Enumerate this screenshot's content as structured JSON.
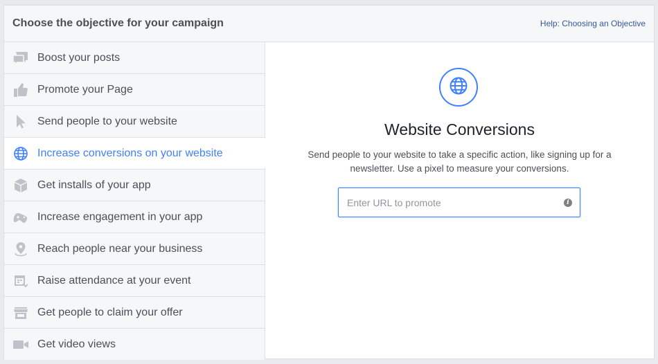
{
  "header": {
    "title": "Choose the objective for your campaign",
    "help_link": "Help: Choosing an Objective"
  },
  "sidebar": {
    "items": [
      {
        "label": "Boost your posts",
        "icon": "speech-bubbles-icon",
        "active": false
      },
      {
        "label": "Promote your Page",
        "icon": "thumbs-up-icon",
        "active": false
      },
      {
        "label": "Send people to your website",
        "icon": "cursor-icon",
        "active": false
      },
      {
        "label": "Increase conversions on your website",
        "icon": "globe-icon",
        "active": true
      },
      {
        "label": "Get installs of your app",
        "icon": "box-icon",
        "active": false
      },
      {
        "label": "Increase engagement in your app",
        "icon": "gamepad-icon",
        "active": false
      },
      {
        "label": "Reach people near your business",
        "icon": "map-pin-icon",
        "active": false
      },
      {
        "label": "Raise attendance at your event",
        "icon": "calendar-icon",
        "active": false
      },
      {
        "label": "Get people to claim your offer",
        "icon": "storefront-icon",
        "active": false
      },
      {
        "label": "Get video views",
        "icon": "video-camera-icon",
        "active": false
      }
    ]
  },
  "main": {
    "icon": "globe-icon",
    "title": "Website Conversions",
    "description": "Send people to your website to take a specific action, like signing up for a newsletter. Use a pixel to measure your conversions.",
    "url_placeholder": "Enter URL to promote",
    "url_value": "",
    "info_icon_glyph": "i"
  },
  "colors": {
    "accent": "#4080ff",
    "icon_gray": "#bec2c9",
    "text": "#4b4f56",
    "border": "#dddfe2",
    "sidebar_bg": "#f6f7f9"
  }
}
